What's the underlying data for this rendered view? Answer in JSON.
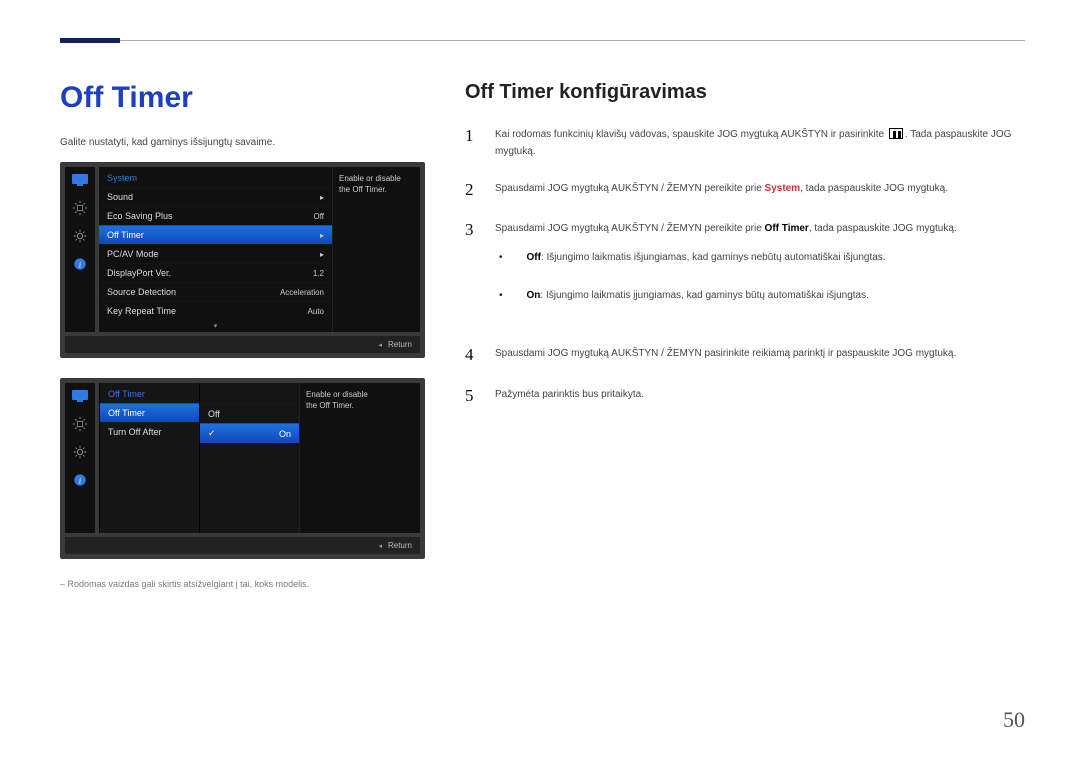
{
  "page_number": "50",
  "heading": "Off Timer",
  "intro": "Galite nustatyti, kad gaminys išsijungtų savaime.",
  "caption": "Rodomas vaizdas gali skirtis atsižvelgiant į tai, koks modelis.",
  "subtitle": "Off Timer konfigūravimas",
  "help_text": "Enable or disable the Off Timer.",
  "return_label": "Return",
  "osd1": {
    "title": "System",
    "rows": [
      {
        "label": "Sound",
        "val": "▸"
      },
      {
        "label": "Eco Saving Plus",
        "val": "Off"
      },
      {
        "label": "Off Timer",
        "val": "▸",
        "selected": true
      },
      {
        "label": "PC/AV Mode",
        "val": "▸"
      },
      {
        "label": "DisplayPort Ver.",
        "val": "1.2"
      },
      {
        "label": "Source Detection",
        "val": "Acceleration"
      },
      {
        "label": "Key Repeat Time",
        "val": "Auto"
      }
    ]
  },
  "osd2": {
    "title": "Off Timer",
    "rows": [
      {
        "label": "Off Timer",
        "selected": true
      },
      {
        "label": "Turn Off After"
      }
    ],
    "options": [
      {
        "label": "Off"
      },
      {
        "label": "On",
        "selected": true
      }
    ]
  },
  "steps": [
    {
      "n": "1",
      "html": "Kai rodomas funkcinių klavišų vadovas, spauskite JOG mygtuką AUKŠTYN ir pasirinkite <span class='menu-icon-inline' data-name='menu-icon' data-interactable='false'></span>. Tada paspauskite JOG mygtuką."
    },
    {
      "n": "2",
      "html": "Spausdami JOG mygtuką AUKŠTYN / ŽEMYN pereikite prie <strong>System</strong>, tada paspauskite JOG mygtuką."
    },
    {
      "n": "3",
      "html": "Spausdami JOG mygtuką AUKŠTYN / ŽEMYN pereikite prie <b>Off Timer</b>, tada paspauskite JOG mygtuką.",
      "sub": [
        "<b>Off</b>: Išjungimo laikmatis išjungiamas, kad gaminys nebūtų automatiškai išjungtas.",
        "<b>On</b>: Išjungimo laikmatis įjungiamas, kad gaminys būtų automatiškai išjungtas."
      ]
    },
    {
      "n": "4",
      "html": "Spausdami JOG mygtuką AUKŠTYN / ŽEMYN pasirinkite reikiamą parinktį ir paspauskite JOG mygtuką."
    },
    {
      "n": "5",
      "html": "Pažymėta parinktis bus pritaikyta."
    }
  ]
}
